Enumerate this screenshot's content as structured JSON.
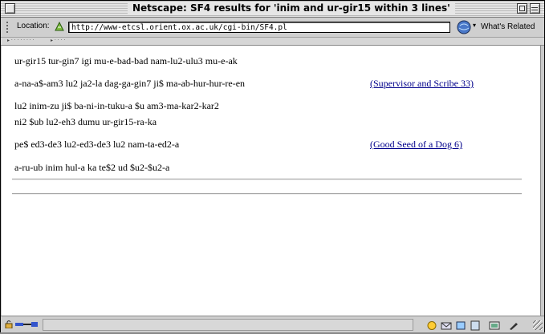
{
  "window": {
    "title": "Netscape: SF4 results for 'inim and ur-gir15 within 3 lines'"
  },
  "location_bar": {
    "label": "Location:",
    "url": "http://www-etcsl.orient.ox.ac.uk/cgi-bin/SF4.pl",
    "related_label": "What's Related"
  },
  "results": [
    {
      "lines": [
        "ur-gir15 tur-gin7 igi mu-e-bad-bad nam-lu2-ulu3 mu-e-ak"
      ],
      "link": ""
    },
    {
      "lines": [
        "a-na-a$-am3 lu2 ja2-la dag-ga-gin7 ji$ ma-ab-hur-hur-re-en"
      ],
      "link": "(Supervisor and Scribe 33)"
    },
    {
      "lines": [
        "lu2 inim-zu ji$ ba-ni-in-tuku-a $u am3-ma-kar2-kar2",
        "ni2 $ub lu2-eh3 dumu ur-gir15-ra-ka"
      ],
      "link": ""
    },
    {
      "lines": [
        "pe$ ed3-de3 lu2-ed3-de3 lu2 nam-ta-ed2-a"
      ],
      "link": "(Good Seed of a Dog 6)"
    },
    {
      "lines": [
        "a-ru-ub inim hul-a ka te$2 ud $u2-$u2-a"
      ],
      "link": ""
    }
  ],
  "icons": {
    "location": "location-proxy-icon",
    "related": "whats-related-icon",
    "lock": "security-lock-icon",
    "connection": "connection-status-icon"
  },
  "colors": {
    "link": "#00008b",
    "chrome": "#c9c9c9"
  }
}
